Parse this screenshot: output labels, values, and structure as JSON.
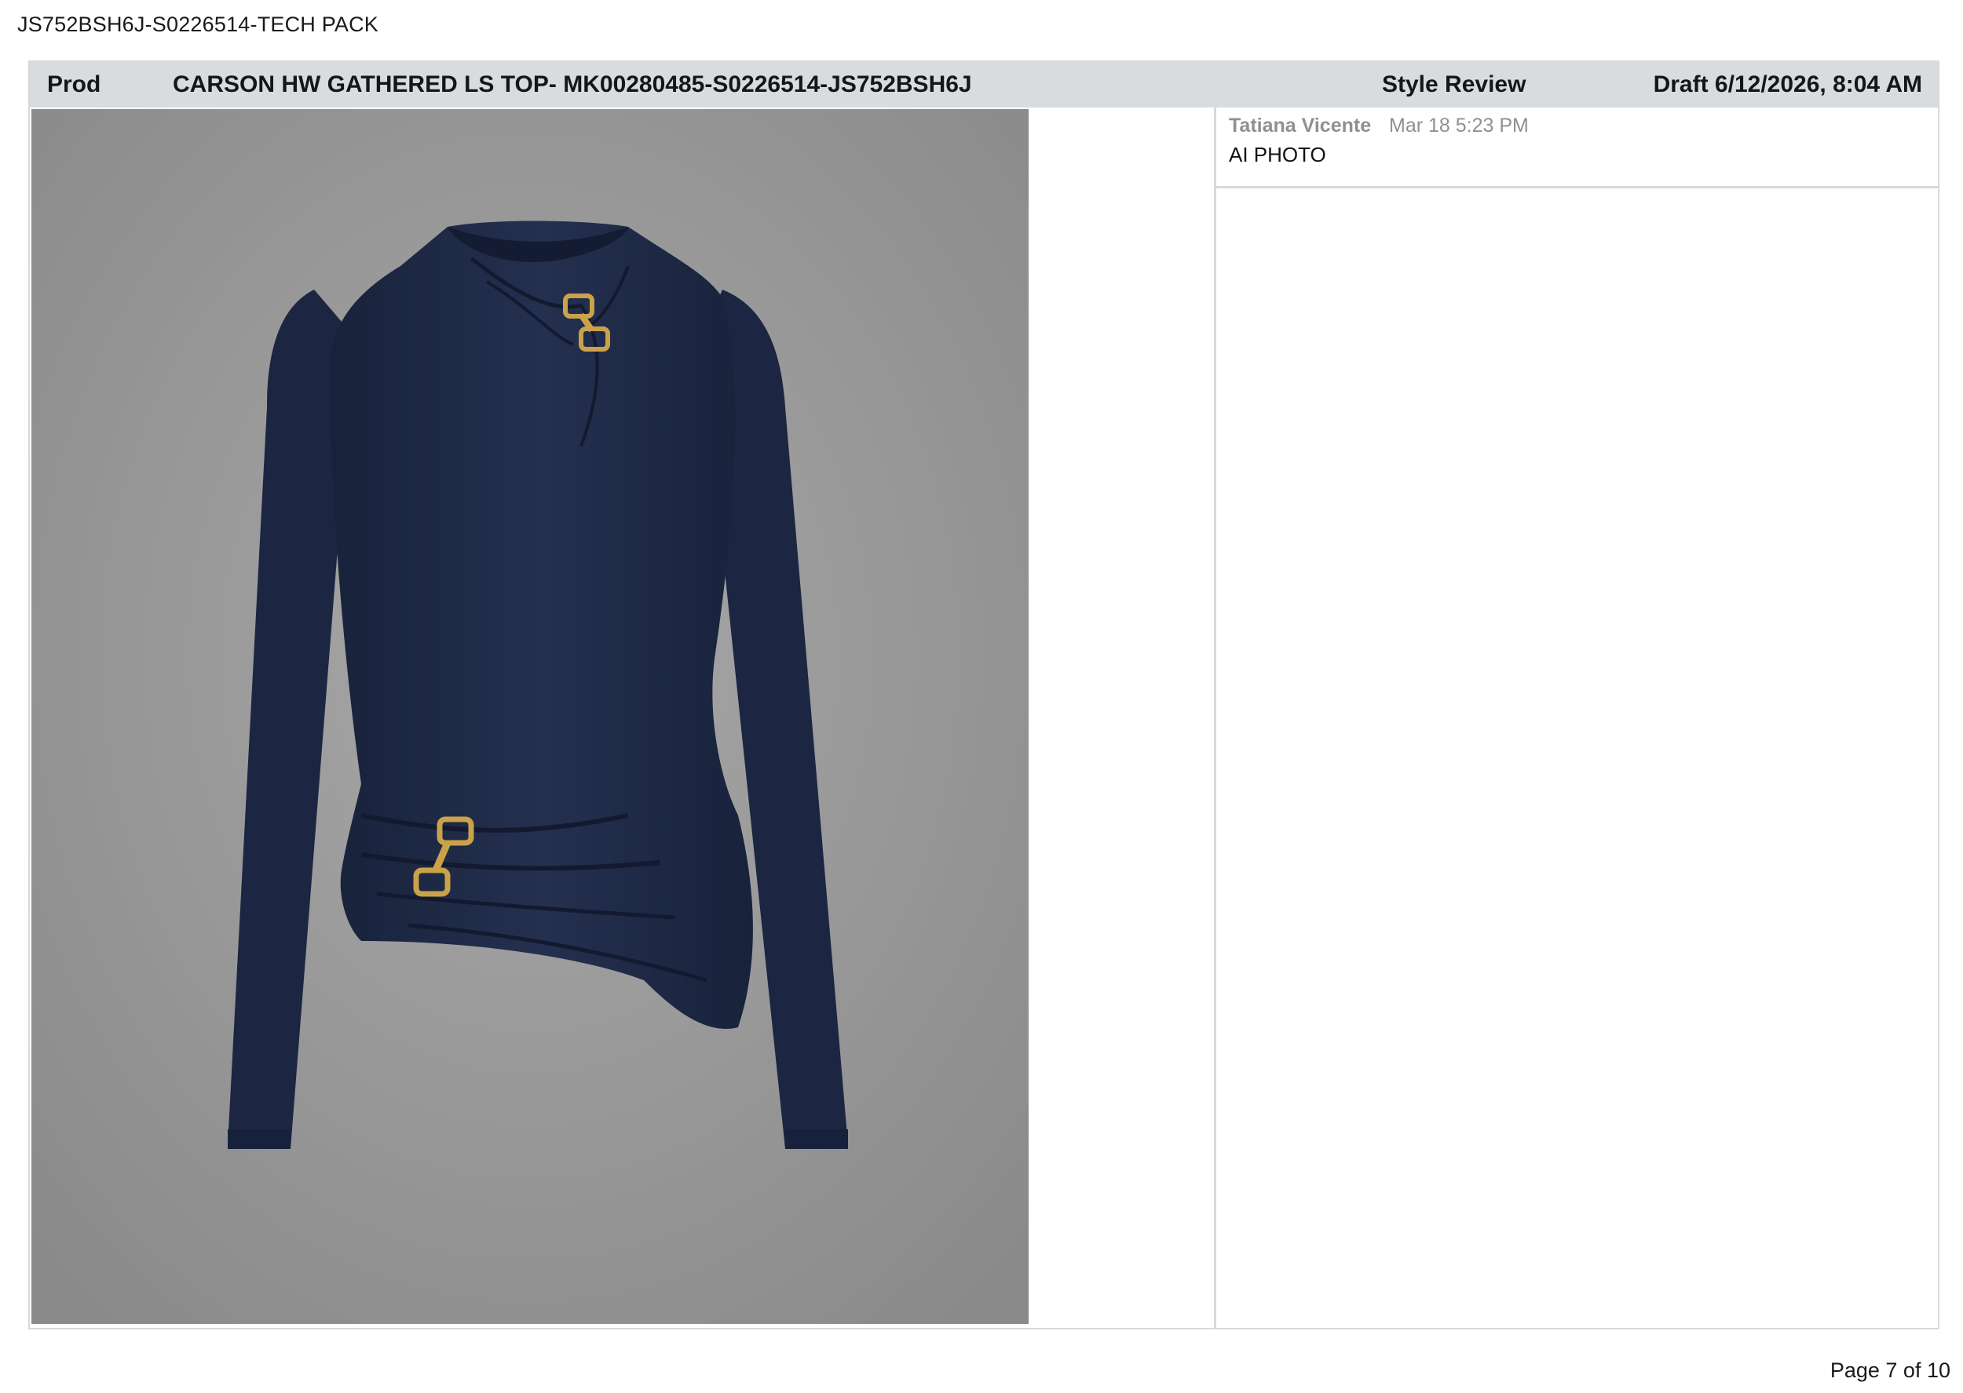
{
  "document": {
    "title": "JS752BSH6J-S0226514-TECH PACK",
    "page_label": "Page 7 of 10"
  },
  "header": {
    "prod_label": "Prod",
    "style_name": "CARSON HW GATHERED LS TOP- MK00280485-S0226514-JS752BSH6J",
    "review_label": "Style Review",
    "draft_label": "Draft 6/12/2026, 8:04 AM"
  },
  "image": {
    "subject": "navy long sleeve gathered top with gold hardware",
    "garment_color": "#1e2a47",
    "hardware_color": "#c9a24a",
    "background_color": "#9e9e9e"
  },
  "comments": [
    {
      "author": "Tatiana Vicente",
      "time": "Mar 18 5:23 PM",
      "text": "AI PHOTO"
    }
  ],
  "colors": {
    "header_bg": "#d9dcdf",
    "border": "#d6d9dd",
    "muted_text": "#8d9095"
  }
}
